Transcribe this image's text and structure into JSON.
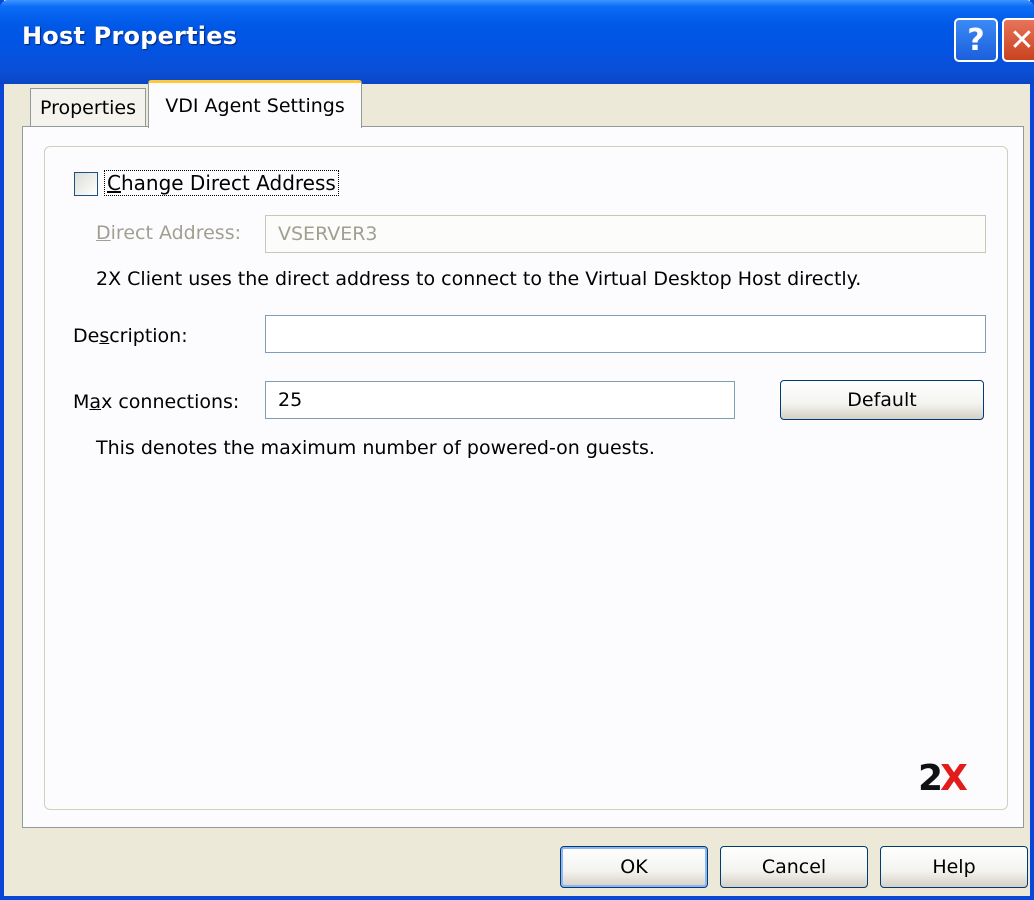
{
  "window": {
    "title": "Host Properties"
  },
  "titlebar": {
    "help_glyph": "?",
    "close_glyph": "✕"
  },
  "tabs": [
    {
      "label": "Properties",
      "active": false
    },
    {
      "label": "VDI Agent Settings",
      "active": true
    }
  ],
  "form": {
    "change_direct_address": {
      "label_pre": "",
      "label_accel": "C",
      "label_post": "hange Direct Address",
      "checked": false
    },
    "direct_address": {
      "label_accel": "D",
      "label_post": "irect Address:",
      "value": "VSERVER3"
    },
    "direct_address_help": "2X Client uses the direct address to connect to the Virtual Desktop Host directly.",
    "description": {
      "label_pre": "De",
      "label_accel": "s",
      "label_post": "cription:",
      "value": ""
    },
    "max_connections": {
      "label_pre": "M",
      "label_accel": "a",
      "label_post": "x connections:",
      "value": "25"
    },
    "default_button": "Default",
    "max_connections_help": "This denotes the maximum number of powered-on guests."
  },
  "logo": {
    "two": "2",
    "x": "X"
  },
  "footer": {
    "ok": "OK",
    "cancel": "Cancel",
    "help": "Help"
  }
}
